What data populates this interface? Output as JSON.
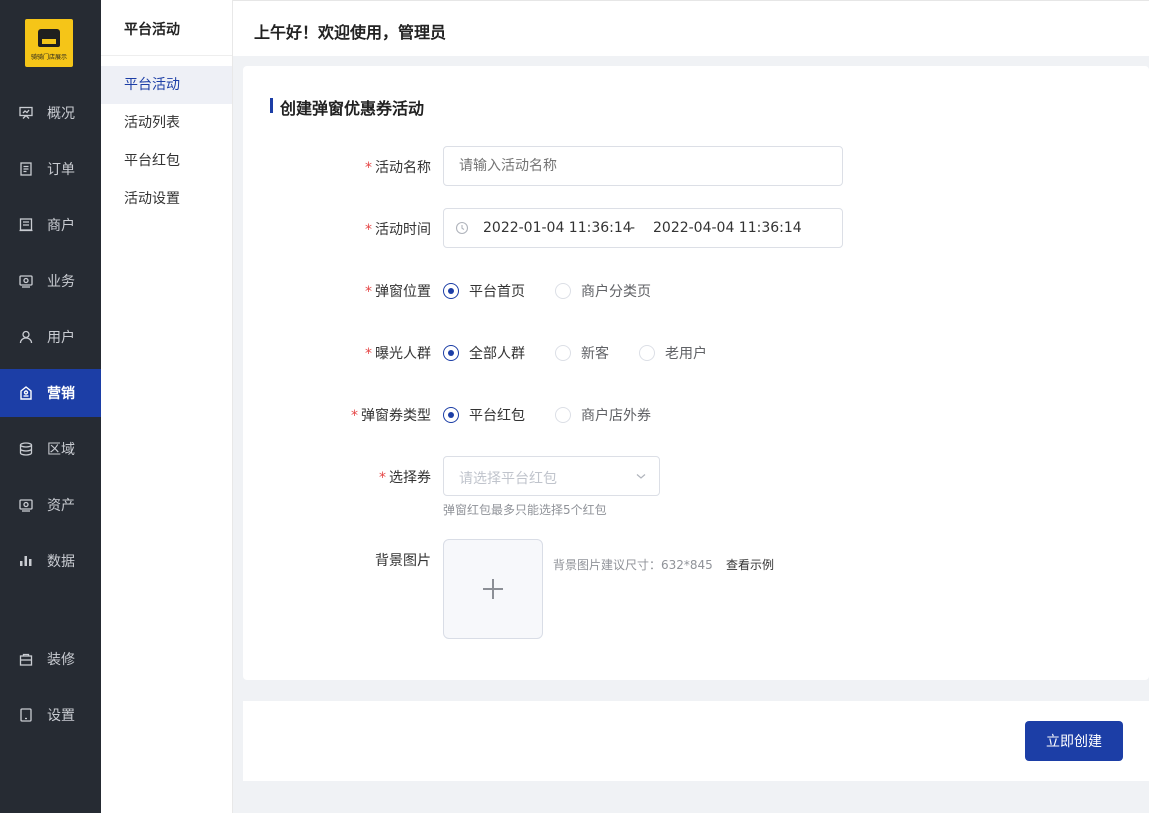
{
  "brand": {
    "logo_text": "骑骑门店展示"
  },
  "sidebar": {
    "items": [
      {
        "label": "概况",
        "icon": "presentation-icon"
      },
      {
        "label": "订单",
        "icon": "document-icon"
      },
      {
        "label": "商户",
        "icon": "store-icon"
      },
      {
        "label": "业务",
        "icon": "briefcase-icon"
      },
      {
        "label": "用户",
        "icon": "user-icon"
      },
      {
        "label": "营销",
        "icon": "tag-icon",
        "active": true
      },
      {
        "label": "区域",
        "icon": "database-icon"
      },
      {
        "label": "资产",
        "icon": "wallet-icon"
      },
      {
        "label": "数据",
        "icon": "bar-chart-icon"
      },
      {
        "label": "装修",
        "icon": "shopping-bag-icon"
      },
      {
        "label": "设置",
        "icon": "tablet-icon"
      }
    ]
  },
  "submenu": {
    "title": "平台活动",
    "items": [
      {
        "label": "平台活动",
        "active": true
      },
      {
        "label": "活动列表"
      },
      {
        "label": "平台红包"
      },
      {
        "label": "活动设置"
      }
    ]
  },
  "header": {
    "greeting": "上午好！欢迎使用，管理员"
  },
  "form": {
    "title": "创建弹窗优惠券活动",
    "required_mark": "*",
    "name": {
      "label": "活动名称",
      "placeholder": "请输入活动名称"
    },
    "time": {
      "label": "活动时间",
      "start": "2022-01-04 11:36:14",
      "separator": "-",
      "end": "2022-04-04 11:36:14"
    },
    "position": {
      "label": "弹窗位置",
      "options": [
        "平台首页",
        "商户分类页"
      ],
      "selected": "平台首页"
    },
    "audience": {
      "label": "曝光人群",
      "options": [
        "全部人群",
        "新客",
        "老用户"
      ],
      "selected": "全部人群"
    },
    "coupon_type": {
      "label": "弹窗券类型",
      "options": [
        "平台红包",
        "商户店外券"
      ],
      "selected": "平台红包"
    },
    "coupon_select": {
      "label": "选择券",
      "placeholder": "请选择平台红包",
      "hint": "弹窗红包最多只能选择5个红包"
    },
    "background": {
      "label": "背景图片",
      "hint": "背景图片建议尺寸：632*845",
      "example_link": "查看示例"
    }
  },
  "footer": {
    "submit_label": "立即创建"
  },
  "colors": {
    "primary": "#1c3ea6",
    "sidebar_bg": "#262b33",
    "required": "#e54545",
    "logo_bg": "#f5c518"
  }
}
